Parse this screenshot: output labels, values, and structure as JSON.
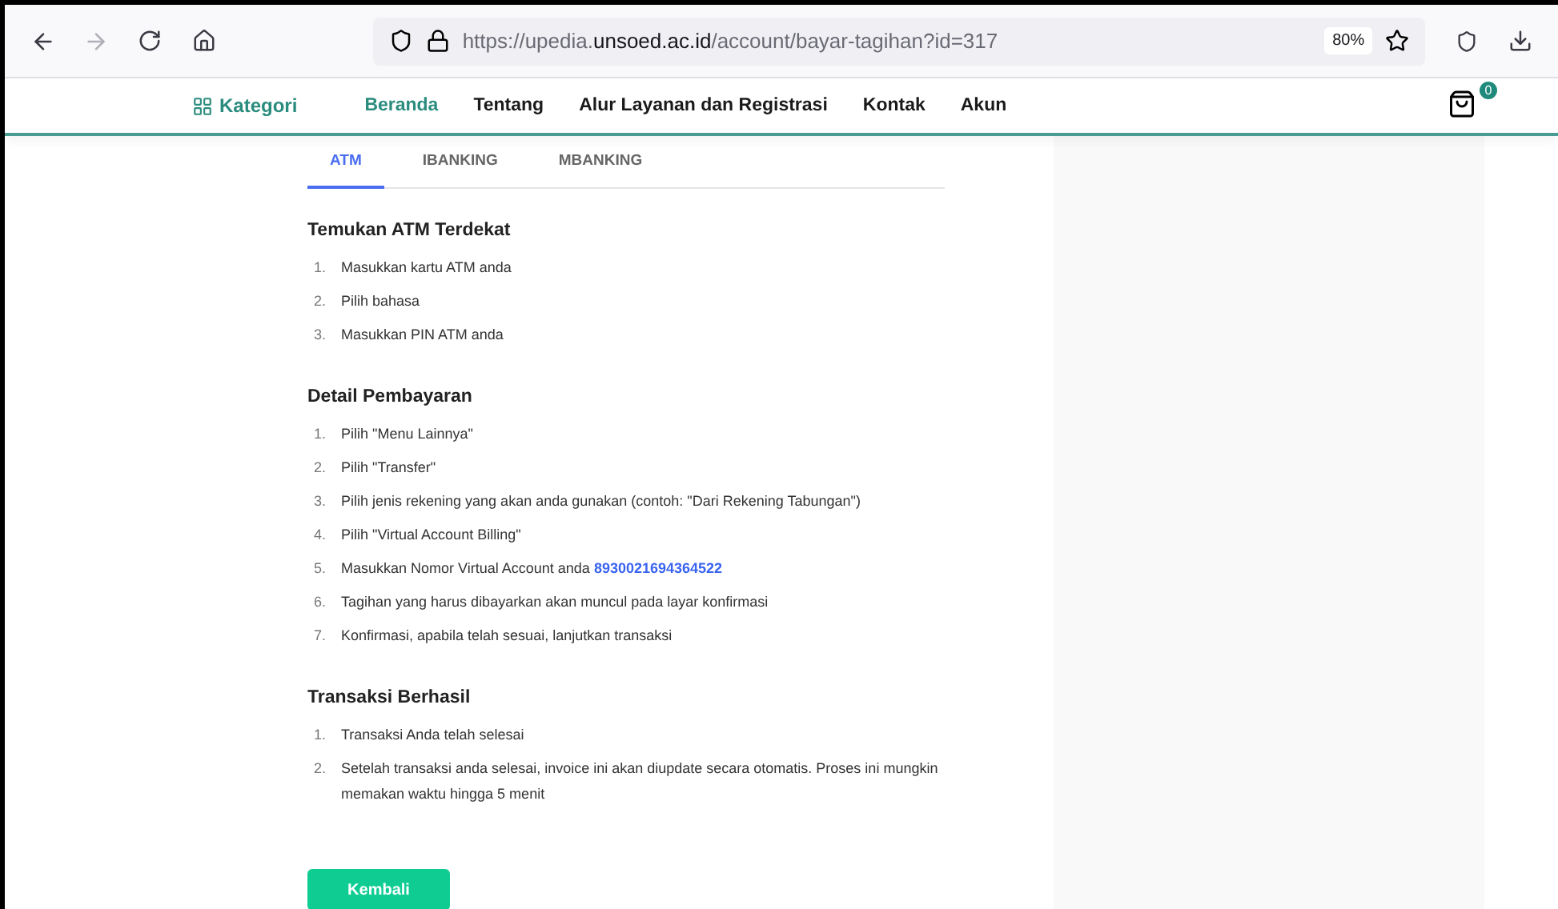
{
  "browser": {
    "url_prefix": "https://upedia.",
    "url_domain": "unsoed.ac.id",
    "url_path": "/account/bayar-tagihan?id=317",
    "zoom": "80%"
  },
  "navbar": {
    "category": "Kategori",
    "links": [
      {
        "label": "Beranda",
        "selected": true
      },
      {
        "label": "Tentang",
        "selected": false
      },
      {
        "label": "Alur Layanan dan Registrasi",
        "selected": false
      },
      {
        "label": "Kontak",
        "selected": false
      },
      {
        "label": "Akun",
        "selected": false
      }
    ],
    "cart_count": "0"
  },
  "tabs": [
    {
      "label": "ATM",
      "selected": true
    },
    {
      "label": "IBANKING",
      "selected": false
    },
    {
      "label": "MBANKING",
      "selected": false
    }
  ],
  "sections": [
    {
      "title": "Temukan ATM Terdekat",
      "steps": [
        {
          "number": "1.",
          "text": "Masukkan kartu ATM anda"
        },
        {
          "number": "2.",
          "text": "Pilih bahasa"
        },
        {
          "number": "3.",
          "text": "Masukkan PIN ATM anda"
        }
      ]
    },
    {
      "title": "Detail Pembayaran",
      "steps": [
        {
          "number": "1.",
          "text": "Pilih \"Menu Lainnya\""
        },
        {
          "number": "2.",
          "text": "Pilih \"Transfer\""
        },
        {
          "number": "3.",
          "text": "Pilih jenis rekening yang akan anda gunakan (contoh: \"Dari Rekening Tabungan\")"
        },
        {
          "number": "4.",
          "text": "Pilih \"Virtual Account Billing\""
        },
        {
          "number": "5.",
          "text": "Masukkan Nomor Virtual Account anda",
          "highlight": "8930021694364522"
        },
        {
          "number": "6.",
          "text": "Tagihan yang harus dibayarkan akan muncul pada layar konfirmasi"
        },
        {
          "number": "7.",
          "text": "Konfirmasi, apabila telah sesuai, lanjutkan transaksi"
        }
      ]
    },
    {
      "title": "Transaksi Berhasil",
      "steps": [
        {
          "number": "1.",
          "text": "Transaksi Anda telah selesai"
        },
        {
          "number": "2.",
          "text": "Setelah transaksi anda selesai, invoice ini akan diupdate secara otomatis. Proses ini mungkin memakan waktu hingga 5 menit"
        }
      ]
    }
  ],
  "back_button": "Kembali"
}
